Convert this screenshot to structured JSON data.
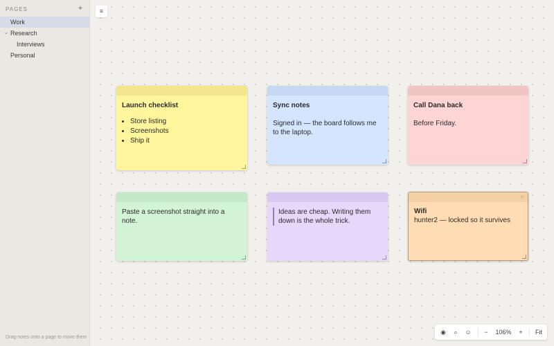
{
  "sidebar": {
    "header": "PAGES",
    "add_label": "+",
    "pages": [
      {
        "label": "Work",
        "active": true
      },
      {
        "label": "Research",
        "expanded": true
      },
      {
        "label": "Interviews",
        "child": true
      },
      {
        "label": "Personal"
      }
    ],
    "footer": "Drag notes onto a page to move them"
  },
  "toolbar": {
    "menu_icon": "menu-icon"
  },
  "notes": [
    {
      "title": "Launch checklist",
      "items": [
        "Store listing",
        "Screenshots",
        "Ship it"
      ],
      "color": "#fff59d",
      "bar": "#f3e68c"
    },
    {
      "title": "Sync notes",
      "text": "Signed in — the board follows me to the laptop.",
      "color": "#d4e6ff",
      "bar": "#c6d9f3"
    },
    {
      "title": "Call Dana back",
      "text": "Before Friday.",
      "color": "#ffd4d4",
      "bar": "#f2c5c5"
    },
    {
      "text": "Paste a screenshot straight into a note.",
      "color": "#d3f3d6",
      "bar": "#c4e8c8"
    },
    {
      "quote": "Ideas are cheap. Writing them down is the whole trick.",
      "color": "#e6d7fb",
      "bar": "#d9c8f2"
    },
    {
      "title": "Wifi",
      "text": "hunter2 — locked so it survives",
      "color": "#ffdcb3",
      "bar": "#f5d0a6",
      "locked": true
    }
  ],
  "zoom": {
    "hand_icon": "eye-icon",
    "search_icon": "search-icon",
    "emoji_icon": "smiley-icon",
    "minus": "−",
    "level": "106%",
    "plus": "+",
    "fit": "Fit"
  }
}
